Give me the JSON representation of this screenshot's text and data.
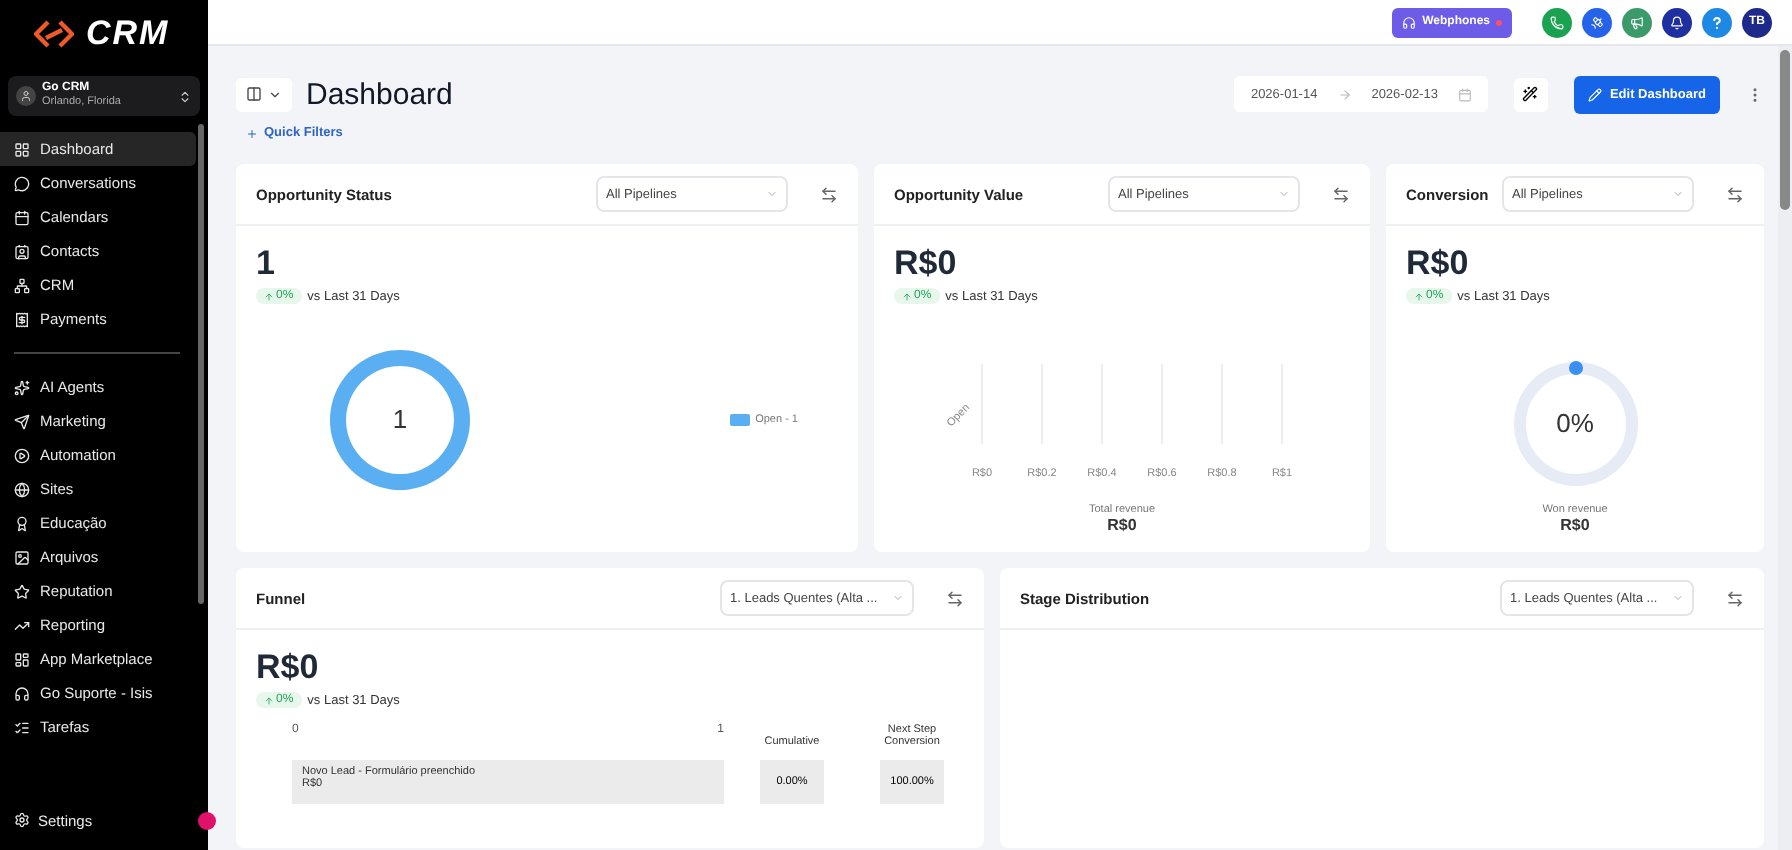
{
  "sidebar": {
    "logo": "CRM",
    "account": {
      "name": "Go CRM",
      "location": "Orlando, Florida"
    },
    "sections": [
      {
        "items": [
          {
            "label": "Dashboard",
            "selected": true
          },
          {
            "label": "Conversations",
            "selected": false
          },
          {
            "label": "Calendars",
            "selected": false
          },
          {
            "label": "Contacts",
            "selected": false
          },
          {
            "label": "CRM",
            "selected": false
          },
          {
            "label": "Payments",
            "selected": false
          }
        ]
      },
      {
        "items": [
          {
            "label": "AI Agents",
            "selected": false
          },
          {
            "label": "Marketing",
            "selected": false
          },
          {
            "label": "Automation",
            "selected": false
          },
          {
            "label": "Sites",
            "selected": false
          },
          {
            "label": "Educação",
            "selected": false
          },
          {
            "label": "Arquivos",
            "selected": false
          },
          {
            "label": "Reputation",
            "selected": false
          },
          {
            "label": "Reporting",
            "selected": false
          },
          {
            "label": "App Marketplace",
            "selected": false
          },
          {
            "label": "Go Suporte - Isis",
            "selected": false
          },
          {
            "label": "Tarefas",
            "selected": false
          }
        ]
      }
    ],
    "settings": "Settings"
  },
  "topbar": {
    "webphones": "Webphones",
    "avatar": "TB"
  },
  "header": {
    "title": "Dashboard",
    "quick_filters": "Quick Filters",
    "date_from": "2026-01-14",
    "date_to": "2026-02-13",
    "edit_button": "Edit Dashboard"
  },
  "cards": [
    {
      "kind": "donut",
      "title": "Opportunity Status",
      "filter": "All Pipelines",
      "value": "1",
      "change": "0%",
      "compare": "vs Last 31 Days",
      "center_label": "1",
      "legend": [
        "Open - 1"
      ]
    },
    {
      "kind": "bar",
      "title": "Opportunity Value",
      "filter": "All Pipelines",
      "value": "R$0",
      "change": "0%",
      "compare": "vs Last 31 Days",
      "total_label": "Total revenue",
      "total": "R$0",
      "category_labels": [
        "Open"
      ],
      "axis_labels": [
        "R$0",
        "R$0.2",
        "R$0.4",
        "R$0.6",
        "R$0.8",
        "R$1"
      ]
    },
    {
      "kind": "gauge",
      "title": "Conversion",
      "filter": "All Pipelines",
      "value": "R$0",
      "change": "0%",
      "compare": "vs Last 31 Days",
      "percent": "0%",
      "total_label": "Won revenue",
      "total": "R$0"
    }
  ],
  "funnel": {
    "title": "Funnel",
    "filter": "1. Leads Quentes (Alta ...",
    "value": "R$0",
    "change": "0%",
    "compare": "vs Last 31 Days",
    "axis": [
      "0",
      "1"
    ],
    "columns": [
      "Cumulative",
      "Next Step Conversion"
    ],
    "rows": [
      {
        "stage": "Novo Lead - Formulário preenchido",
        "amount": "R$0",
        "cumulative": "0.00%",
        "next_step": "100.00%"
      }
    ]
  },
  "stage_distribution": {
    "title": "Stage Distribution",
    "filter": "1. Leads Quentes (Alta ..."
  }
}
